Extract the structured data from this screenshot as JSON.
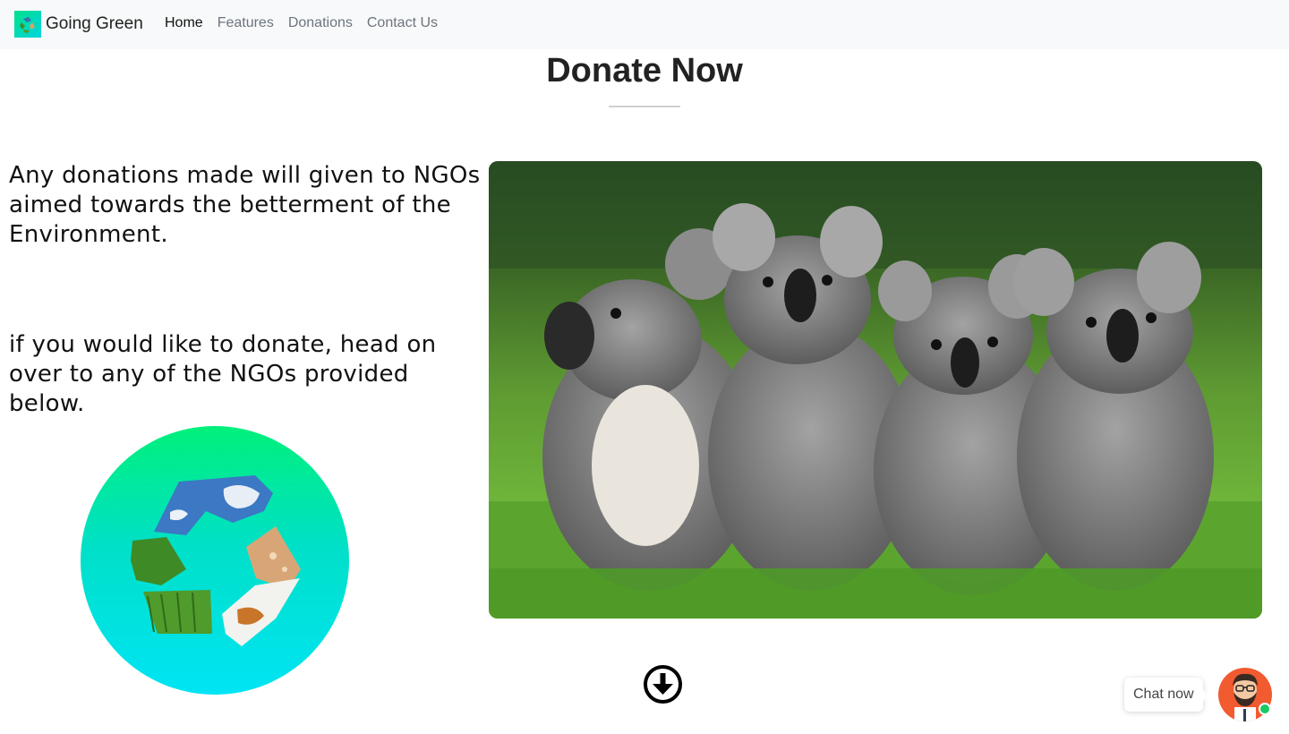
{
  "navbar": {
    "brand": "Going Green",
    "links": [
      {
        "label": "Home",
        "active": true
      },
      {
        "label": "Features",
        "active": false
      },
      {
        "label": "Donations",
        "active": false
      },
      {
        "label": "Contact Us",
        "active": false
      }
    ]
  },
  "main": {
    "title": "Donate Now",
    "paragraph1": "Any donations made will given to NGOs aimed towards the betterment of the Environment.",
    "paragraph2": "if you would like to donate, head on over to any of the NGOs provided below."
  },
  "images": {
    "recycle": "recycle-icon",
    "photo": "koala-photo"
  },
  "chat": {
    "label": "Chat now",
    "status_color": "#18c964",
    "avatar_color": "#f25a30"
  },
  "colors": {
    "navbar_bg": "#f8f9fa",
    "brand_gradient": [
      "#00e08a",
      "#00d4e0"
    ]
  }
}
